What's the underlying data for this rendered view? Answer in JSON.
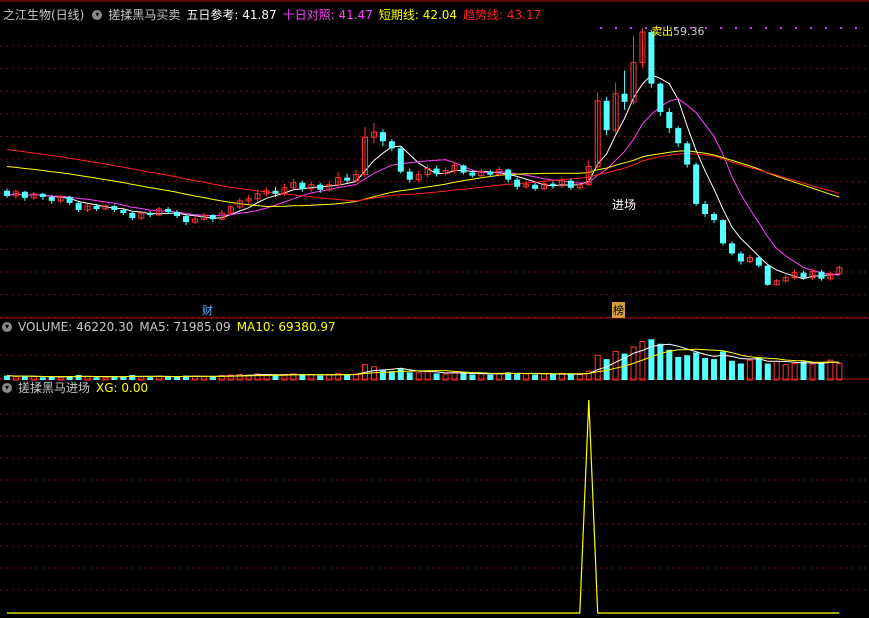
{
  "header_main": {
    "stock": "之江生物(日线)",
    "indicator": "搓揉黑马买卖",
    "ma5_label": "五日参考: ",
    "ma5_value": "41.87",
    "ma10_label": "十日对照: ",
    "ma10_value": "41.47",
    "short_label": "短期线: ",
    "short_value": "42.04",
    "trend_label": "趋势线: ",
    "trend_value": "43.17"
  },
  "header_volume": {
    "label": "VOLUME: ",
    "value": "46220.30",
    "ma5_label": "MA5: ",
    "ma5_value": "71985.09",
    "ma10_label": "MA10: ",
    "ma10_value": "69380.97"
  },
  "header_signal": {
    "name": "搓揉黑马进场",
    "xg_label": "XG: ",
    "xg_value": "0.00"
  },
  "annotations": {
    "enter": "进场",
    "sell": "卖出",
    "peak": "59.36",
    "fin": "财",
    "rank": "榜"
  },
  "colors": {
    "up": "#ff3232",
    "down": "#54ffff",
    "ma5": "#ffffff",
    "ma10": "#ff40ff",
    "short": "#ffff00",
    "trend": "#ff2020",
    "grid": "#7a1010",
    "signal": "#ffff00"
  },
  "chart_data": [
    {
      "type": "candlestick",
      "series": [
        {
          "name": "五日参考",
          "last": 41.87
        },
        {
          "name": "十日对照",
          "last": 41.47
        },
        {
          "name": "短期线",
          "last": 42.04
        },
        {
          "name": "趋势线",
          "last": 43.17
        }
      ],
      "annotations": [
        "进场",
        "卖出",
        "59.36",
        "财",
        "榜"
      ],
      "candles": [
        [
          43.3,
          42.8,
          43.5,
          42.6
        ],
        [
          42.8,
          43.2,
          43.4,
          42.5
        ],
        [
          43.2,
          42.6,
          43.3,
          42.3
        ],
        [
          42.6,
          43.0,
          43.2,
          42.4
        ],
        [
          43.0,
          42.7,
          43.1,
          42.4
        ],
        [
          42.7,
          42.3,
          42.9,
          42.0
        ],
        [
          42.3,
          42.7,
          42.9,
          42.1
        ],
        [
          42.7,
          42.1,
          42.8,
          41.9
        ],
        [
          42.1,
          41.4,
          42.2,
          41.2
        ],
        [
          41.4,
          41.8,
          42.0,
          41.2
        ],
        [
          41.8,
          41.5,
          42.0,
          41.3
        ],
        [
          41.5,
          41.8,
          42.0,
          41.4
        ],
        [
          41.8,
          41.4,
          41.9,
          41.2
        ],
        [
          41.4,
          41.1,
          41.5,
          40.9
        ],
        [
          41.1,
          40.6,
          41.2,
          40.4
        ],
        [
          40.6,
          41.1,
          41.3,
          40.4
        ],
        [
          41.1,
          40.9,
          41.3,
          40.7
        ],
        [
          40.9,
          41.5,
          41.7,
          40.8
        ],
        [
          41.5,
          41.2,
          41.7,
          41.0
        ],
        [
          41.2,
          40.8,
          41.4,
          40.6
        ],
        [
          40.8,
          40.2,
          40.9,
          39.9
        ],
        [
          40.2,
          40.5,
          40.8,
          40.0
        ],
        [
          40.5,
          40.9,
          41.1,
          40.3
        ],
        [
          40.9,
          40.5,
          41.0,
          40.2
        ],
        [
          40.5,
          41.1,
          41.4,
          40.4
        ],
        [
          41.1,
          41.7,
          41.9,
          40.9
        ],
        [
          41.7,
          42.3,
          42.6,
          41.5
        ],
        [
          42.3,
          42.5,
          42.9,
          42.0
        ],
        [
          42.5,
          43.0,
          43.4,
          42.2
        ],
        [
          43.0,
          43.3,
          43.6,
          42.8
        ],
        [
          43.3,
          43.0,
          43.7,
          42.7
        ],
        [
          43.0,
          43.6,
          44.0,
          42.8
        ],
        [
          43.6,
          44.1,
          44.5,
          43.4
        ],
        [
          44.1,
          43.5,
          44.3,
          43.2
        ],
        [
          43.5,
          43.9,
          44.2,
          43.2
        ],
        [
          43.9,
          43.4,
          44.1,
          43.1
        ],
        [
          43.4,
          43.9,
          44.3,
          43.2
        ],
        [
          43.9,
          44.6,
          45.2,
          43.7
        ],
        [
          44.6,
          44.3,
          45.0,
          44.0
        ],
        [
          44.3,
          44.9,
          45.4,
          44.1
        ],
        [
          44.9,
          48.6,
          49.6,
          44.7
        ],
        [
          48.6,
          49.1,
          50.0,
          48.0
        ],
        [
          49.1,
          48.2,
          49.4,
          47.7
        ],
        [
          48.2,
          47.5,
          48.4,
          47.2
        ],
        [
          47.5,
          45.2,
          47.7,
          45.0
        ],
        [
          45.2,
          44.4,
          45.5,
          44.1
        ],
        [
          44.4,
          44.9,
          45.3,
          44.1
        ],
        [
          44.9,
          45.5,
          45.9,
          44.6
        ],
        [
          45.5,
          45.0,
          45.8,
          44.7
        ],
        [
          45.0,
          45.3,
          45.6,
          44.8
        ],
        [
          45.3,
          45.8,
          46.1,
          45.0
        ],
        [
          45.8,
          45.1,
          45.9,
          44.9
        ],
        [
          45.1,
          44.8,
          45.3,
          44.6
        ],
        [
          44.8,
          45.2,
          45.5,
          44.6
        ],
        [
          45.2,
          44.9,
          45.4,
          44.7
        ],
        [
          44.9,
          45.4,
          45.7,
          44.7
        ],
        [
          45.4,
          44.4,
          45.5,
          44.1
        ],
        [
          44.4,
          43.7,
          44.6,
          43.4
        ],
        [
          43.7,
          43.9,
          44.3,
          43.5
        ],
        [
          43.9,
          43.5,
          44.1,
          43.3
        ],
        [
          43.5,
          44.0,
          44.3,
          43.3
        ],
        [
          44.0,
          43.8,
          44.2,
          43.5
        ],
        [
          43.8,
          44.3,
          44.6,
          43.6
        ],
        [
          44.3,
          43.6,
          44.5,
          43.4
        ],
        [
          43.6,
          43.9,
          44.2,
          43.4
        ],
        [
          43.9,
          45.7,
          46.3,
          43.8
        ],
        [
          45.7,
          52.2,
          53.0,
          45.5
        ],
        [
          52.2,
          49.3,
          52.6,
          48.8
        ],
        [
          49.3,
          52.9,
          54.0,
          49.0
        ],
        [
          52.9,
          52.1,
          55.2,
          51.3
        ],
        [
          52.1,
          56.0,
          58.6,
          51.8
        ],
        [
          56.0,
          59.0,
          59.4,
          55.5
        ],
        [
          59.0,
          53.9,
          59.2,
          53.5
        ],
        [
          53.9,
          51.1,
          54.0,
          50.7
        ],
        [
          51.1,
          49.5,
          51.5,
          49.0
        ],
        [
          49.5,
          48.0,
          49.7,
          47.6
        ],
        [
          48.0,
          45.9,
          48.2,
          45.6
        ],
        [
          45.9,
          42.0,
          46.1,
          41.8
        ],
        [
          42.0,
          41.0,
          42.3,
          40.7
        ],
        [
          41.0,
          40.4,
          41.2,
          40.1
        ],
        [
          40.4,
          38.1,
          40.5,
          37.9
        ],
        [
          38.1,
          37.1,
          38.3,
          36.9
        ],
        [
          37.1,
          36.3,
          37.3,
          36.0
        ],
        [
          36.3,
          36.7,
          37.0,
          36.1
        ],
        [
          36.7,
          35.9,
          36.9,
          35.7
        ],
        [
          35.9,
          34.0,
          36.1,
          33.9
        ],
        [
          34.0,
          34.4,
          34.6,
          33.9
        ],
        [
          34.4,
          34.7,
          35.0,
          34.2
        ],
        [
          34.7,
          35.2,
          35.5,
          34.5
        ],
        [
          35.2,
          34.7,
          35.4,
          34.5
        ],
        [
          34.7,
          35.3,
          35.6,
          34.5
        ],
        [
          35.3,
          34.6,
          35.5,
          34.4
        ],
        [
          34.6,
          35.1,
          35.3,
          34.4
        ],
        [
          35.1,
          35.7,
          35.9,
          34.9
        ]
      ],
      "volume": [
        8,
        6,
        7,
        6,
        5,
        6,
        5,
        7,
        9,
        6,
        5,
        5,
        6,
        7,
        9,
        6,
        5,
        7,
        6,
        6,
        8,
        7,
        6,
        6,
        8,
        9,
        10,
        9,
        11,
        10,
        8,
        10,
        11,
        9,
        10,
        8,
        9,
        12,
        10,
        11,
        28,
        24,
        18,
        16,
        20,
        14,
        13,
        15,
        12,
        11,
        14,
        12,
        10,
        11,
        10,
        12,
        14,
        13,
        11,
        10,
        11,
        10,
        12,
        11,
        10,
        16,
        45,
        38,
        52,
        48,
        60,
        70,
        74,
        66,
        55,
        42,
        45,
        50,
        40,
        38,
        52,
        35,
        30,
        36,
        40,
        30,
        34,
        28,
        30,
        34,
        29,
        31,
        36,
        30
      ],
      "volume_ma5_last": 71985.09,
      "volume_ma10_last": 69380.97,
      "signal": {
        "name": "XG",
        "last": 0.0,
        "spike_bar": 65
      }
    }
  ]
}
